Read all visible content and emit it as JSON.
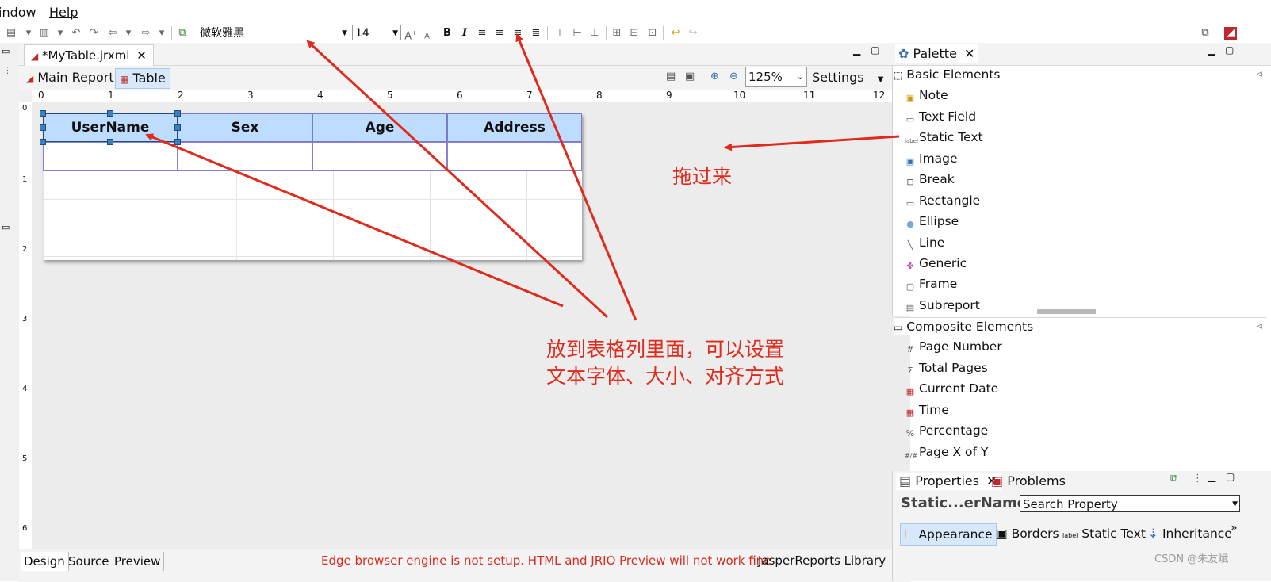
{
  "menu": {
    "window": "indow",
    "help": "Help"
  },
  "toolbar": {
    "font_family": "微软雅黑",
    "font_size": "14",
    "increase_font": "A",
    "decrease_font": "A",
    "bold": "B",
    "italic": "I"
  },
  "editor": {
    "file_tab": "*MyTable.jrxml",
    "main_report_tab": "Main Report",
    "table_tab": "Table",
    "zoom": "125%",
    "settings": "Settings",
    "ruler_h": [
      "0",
      "1",
      "2",
      "3",
      "4",
      "5",
      "6",
      "7",
      "8",
      "9",
      "10",
      "11",
      "12"
    ],
    "ruler_v": [
      "0",
      "1",
      "2",
      "3",
      "4",
      "5",
      "6"
    ],
    "table_headers": [
      "UserName",
      "Sex",
      "Age",
      "Address"
    ]
  },
  "bottom": {
    "tabs": [
      "Design",
      "Source",
      "Preview"
    ],
    "warning": "Edge browser engine is not setup. HTML and JRIO Preview will not work fine",
    "library": "JasperReports Library"
  },
  "palette": {
    "title": "Palette",
    "basic_section": "Basic Elements",
    "basic_items": [
      "Note",
      "Text Field",
      "Static Text",
      "Image",
      "Break",
      "Rectangle",
      "Ellipse",
      "Line",
      "Generic",
      "Frame",
      "Subreport"
    ],
    "composite_section": "Composite Elements",
    "composite_items": [
      "Page Number",
      "Total Pages",
      "Current Date",
      "Time",
      "Percentage",
      "Page X of Y"
    ]
  },
  "properties": {
    "tab_properties": "Properties",
    "tab_problems": "Problems",
    "element_name": "Static...erName",
    "search_placeholder": "Search Property",
    "tabs": [
      "Appearance",
      "Borders",
      "Static Text",
      "Inheritance"
    ]
  },
  "annotations": {
    "drag_here": "拖过来",
    "line1": "放到表格列里面，可以设置",
    "line2": "文本字体、大小、对齐方式"
  },
  "watermark": "CSDN @朱友斌",
  "colors": {
    "annotation": "#e02a1c",
    "table_header": "#bedcff",
    "selection_handle": "#3e7fc1"
  }
}
